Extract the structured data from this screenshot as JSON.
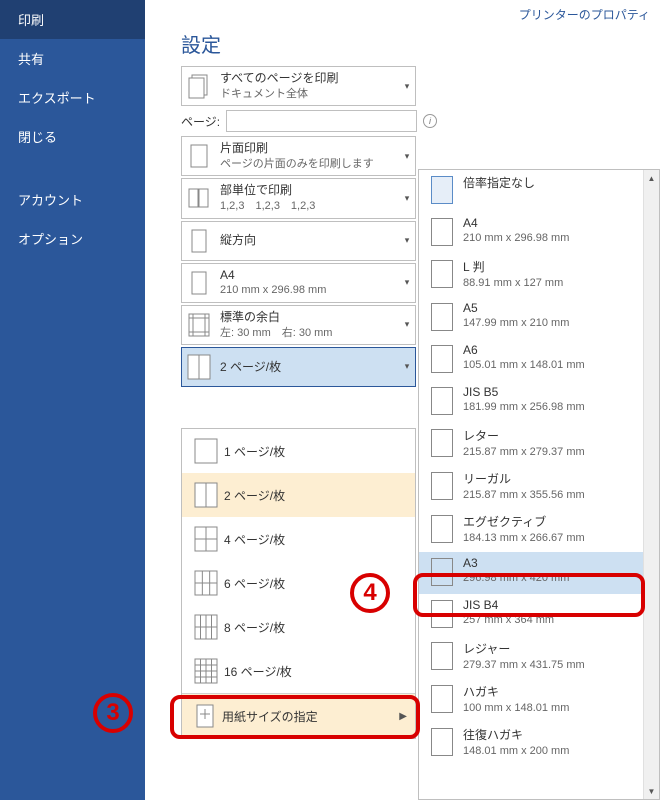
{
  "sidebar": {
    "items": [
      {
        "label": "印刷",
        "selected": true
      },
      {
        "label": "共有"
      },
      {
        "label": "エクスポート"
      },
      {
        "label": "閉じる"
      },
      {
        "spacer": true
      },
      {
        "label": "アカウント"
      },
      {
        "label": "オプション"
      }
    ]
  },
  "printer_properties_link": "プリンターのプロパティ",
  "settings_heading": "設定",
  "settings": [
    {
      "primary": "すべてのページを印刷",
      "secondary": "ドキュメント全体",
      "icon": "pages-all"
    },
    {
      "type": "pages_row",
      "label": "ページ:",
      "value": ""
    },
    {
      "primary": "片面印刷",
      "secondary": "ページの片面のみを印刷します",
      "icon": "page-single"
    },
    {
      "primary": "部単位で印刷",
      "secondary": "1,2,3　1,2,3　1,2,3",
      "icon": "collate"
    },
    {
      "primary": "縦方向",
      "secondary": "",
      "icon": "portrait"
    },
    {
      "primary": "A4",
      "secondary": "210 mm x 296.98 mm",
      "icon": "page-blank"
    },
    {
      "primary": "標準の余白",
      "secondary": "左: 30 mm　右: 30 mm",
      "icon": "margins"
    },
    {
      "primary": "2 ページ/枚",
      "secondary": "",
      "icon": "pps2",
      "selected": true
    }
  ],
  "pages_per_sheet": {
    "items": [
      {
        "label": "1 ページ/枚",
        "icon": "pps1"
      },
      {
        "label": "2 ページ/枚",
        "icon": "pps2",
        "selected": true
      },
      {
        "label": "4 ページ/枚",
        "icon": "pps4"
      },
      {
        "label": "6 ページ/枚",
        "icon": "pps6"
      },
      {
        "label": "8 ページ/枚",
        "icon": "pps8"
      },
      {
        "label": "16 ページ/枚",
        "icon": "pps16"
      }
    ],
    "footer_label": "用紙サイズの指定"
  },
  "paper_sizes": [
    {
      "name": "倍率指定なし",
      "dim": "",
      "first": true
    },
    {
      "name": "A4",
      "dim": "210 mm x 296.98 mm"
    },
    {
      "name": "L 判",
      "dim": "88.91 mm x 127 mm"
    },
    {
      "name": "A5",
      "dim": "147.99 mm x 210 mm"
    },
    {
      "name": "A6",
      "dim": "105.01 mm x 148.01 mm"
    },
    {
      "name": "JIS B5",
      "dim": "181.99 mm x 256.98 mm"
    },
    {
      "name": "レター",
      "dim": "215.87 mm x 279.37 mm"
    },
    {
      "name": "リーガル",
      "dim": "215.87 mm x 355.56 mm"
    },
    {
      "name": "エグゼクティブ",
      "dim": "184.13 mm x 266.67 mm"
    },
    {
      "name": "A3",
      "dim": "296.98 mm x 420 mm",
      "selected": true
    },
    {
      "name": "JIS B4",
      "dim": "257 mm x 364 mm"
    },
    {
      "name": "レジャー",
      "dim": "279.37 mm x 431.75 mm"
    },
    {
      "name": "ハガキ",
      "dim": "100 mm x 148.01 mm"
    },
    {
      "name": "往復ハガキ",
      "dim": "148.01 mm x 200 mm"
    }
  ],
  "callouts": {
    "c3": "3",
    "c4": "4"
  }
}
